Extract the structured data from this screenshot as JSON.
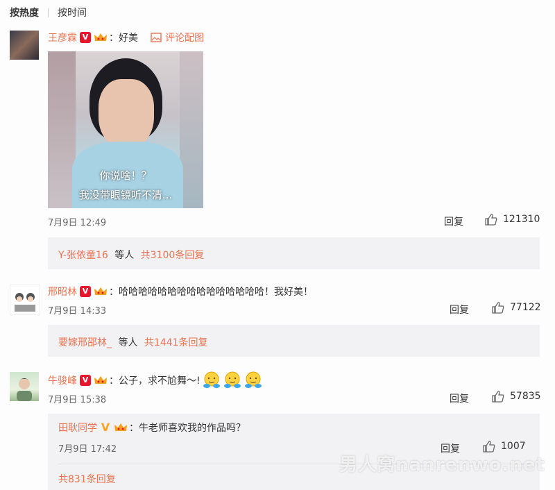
{
  "tabs": {
    "hot": "按热度",
    "time": "按时间"
  },
  "comments": [
    {
      "name": "王彦霖",
      "text": "：好美",
      "attachment": "评论配图",
      "image_caption": "你说啥！？",
      "image_caption2": "我没带眼镜听不清...",
      "date": "7月9日 12:49",
      "reply_label": "回复",
      "likes": "121310",
      "replies_user": "Y-张依童16",
      "replies_mid": "等人",
      "replies_total": "共3100条回复"
    },
    {
      "name": "邢昭林",
      "text": "：哈哈哈哈哈哈哈哈哈哈哈哈哈哈哈！我好美！",
      "date": "7月9日 14:33",
      "reply_label": "回复",
      "likes": "77122",
      "replies_user": "要嫁邢邵林_",
      "replies_mid": "等人",
      "replies_total": "共1441条回复"
    },
    {
      "name": "牛骏峰",
      "text": "：公子，求不尬舞～!",
      "date": "7月9日 15:38",
      "reply_label": "回复",
      "likes": "57835",
      "sub_reply": {
        "name": "田耿同学",
        "text": "：牛老师喜欢我的作品吗？",
        "date": "7月9日 17:42",
        "reply_label": "回复",
        "likes": "1007"
      },
      "replies_total": "共831条回复"
    }
  ],
  "watermark": "男人窝nanrenwo.net",
  "colors": {
    "accent": "#eb7350",
    "reply_bg": "#f2f2f5",
    "verified": "#e6162d"
  }
}
